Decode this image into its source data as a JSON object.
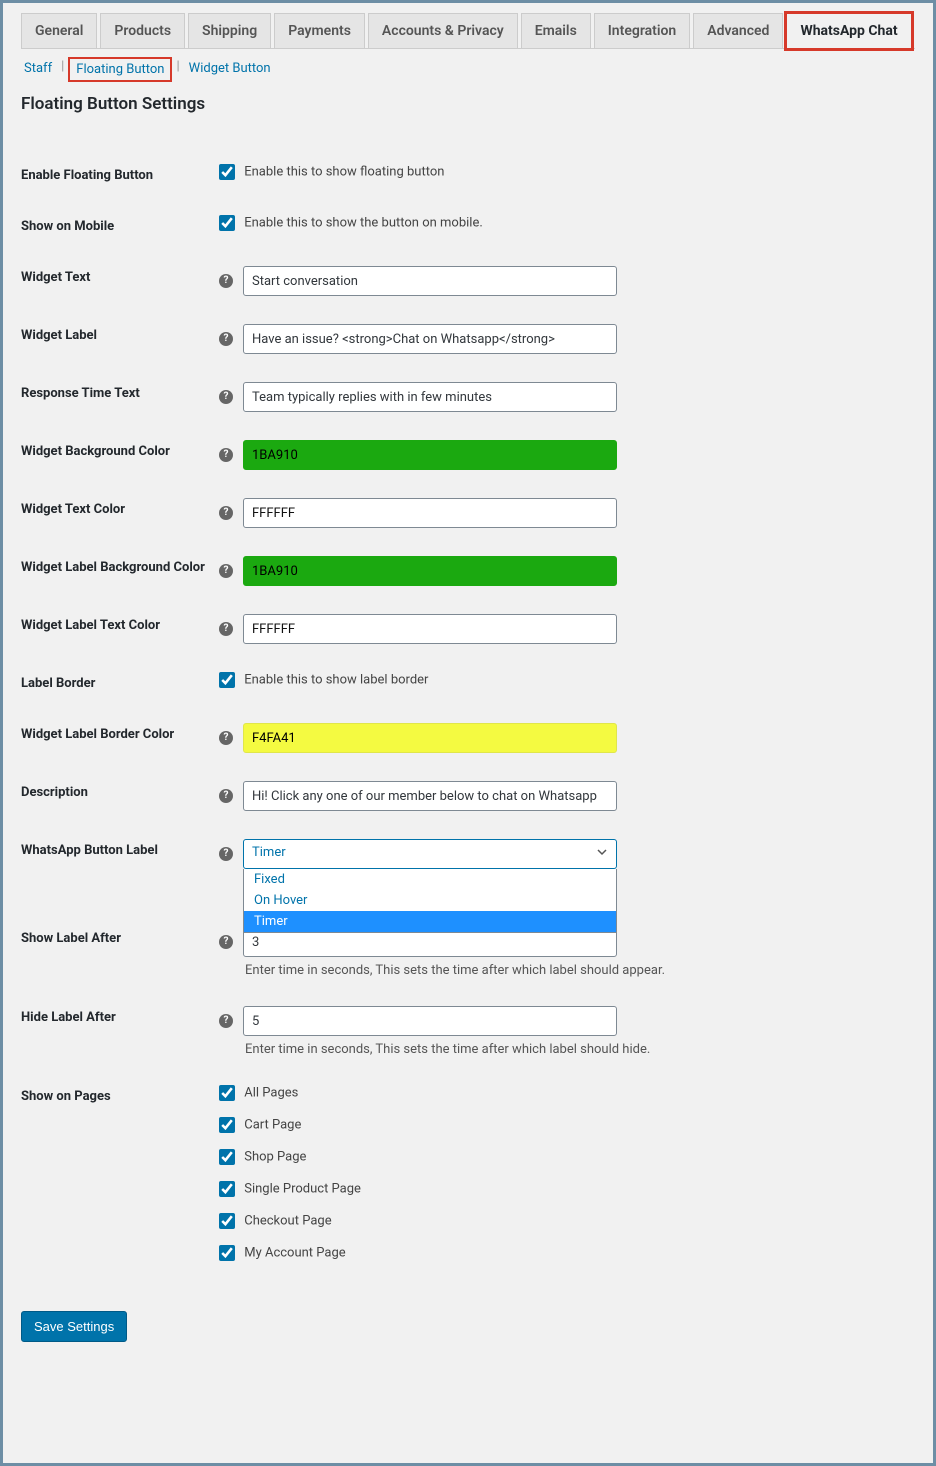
{
  "tabs": {
    "items": [
      "General",
      "Products",
      "Shipping",
      "Payments",
      "Accounts & Privacy",
      "Emails",
      "Integration",
      "Advanced",
      "WhatsApp Chat"
    ]
  },
  "subtabs": {
    "items": [
      "Staff",
      "Floating Button",
      "Widget Button"
    ]
  },
  "section_title": "Floating Button Settings",
  "form": {
    "enable_floating_button": {
      "label": "Enable Floating Button",
      "cb_label": "Enable this to show floating button"
    },
    "show_on_mobile": {
      "label": "Show on Mobile",
      "cb_label": "Enable this to show the button on mobile."
    },
    "widget_text": {
      "label": "Widget Text",
      "value": "Start conversation"
    },
    "widget_label": {
      "label": "Widget Label",
      "value": "Have an issue? <strong>Chat on Whatsapp</strong>"
    },
    "response_time_text": {
      "label": "Response Time Text",
      "value": "Team typically replies with in few minutes"
    },
    "widget_bg_color": {
      "label": "Widget Background Color",
      "value": "1BA910",
      "bg": "#1BA910"
    },
    "widget_text_color": {
      "label": "Widget Text Color",
      "value": "FFFFFF",
      "bg": "#FFFFFF"
    },
    "widget_label_bg_color": {
      "label": "Widget Label Background Color",
      "value": "1BA910",
      "bg": "#1BA910"
    },
    "widget_label_text_color": {
      "label": "Widget Label Text Color",
      "value": "FFFFFF",
      "bg": "#FFFFFF"
    },
    "label_border": {
      "label": "Label Border",
      "cb_label": "Enable this to show label border"
    },
    "widget_label_border_color": {
      "label": "Widget Label Border Color",
      "value": "F4FA41",
      "bg": "#F4FA41"
    },
    "description": {
      "label": "Description",
      "value": "Hi! Click any one of our member below to chat on Whatsapp"
    },
    "whatsapp_button_label": {
      "label": "WhatsApp Button Label",
      "selected": "Timer",
      "options": [
        "Fixed",
        "On Hover",
        "Timer"
      ]
    },
    "show_label_after": {
      "label": "Show Label After",
      "value": "3",
      "desc": "Enter time in seconds, This sets the time after which label should appear."
    },
    "hide_label_after": {
      "label": "Hide Label After",
      "value": "5",
      "desc": "Enter time in seconds, This sets the time after which label should hide."
    },
    "show_on_pages": {
      "label": "Show on Pages",
      "options": [
        "All Pages",
        "Cart Page",
        "Shop Page",
        "Single Product Page",
        "Checkout Page",
        "My Account Page"
      ]
    }
  },
  "save_button": "Save Settings"
}
